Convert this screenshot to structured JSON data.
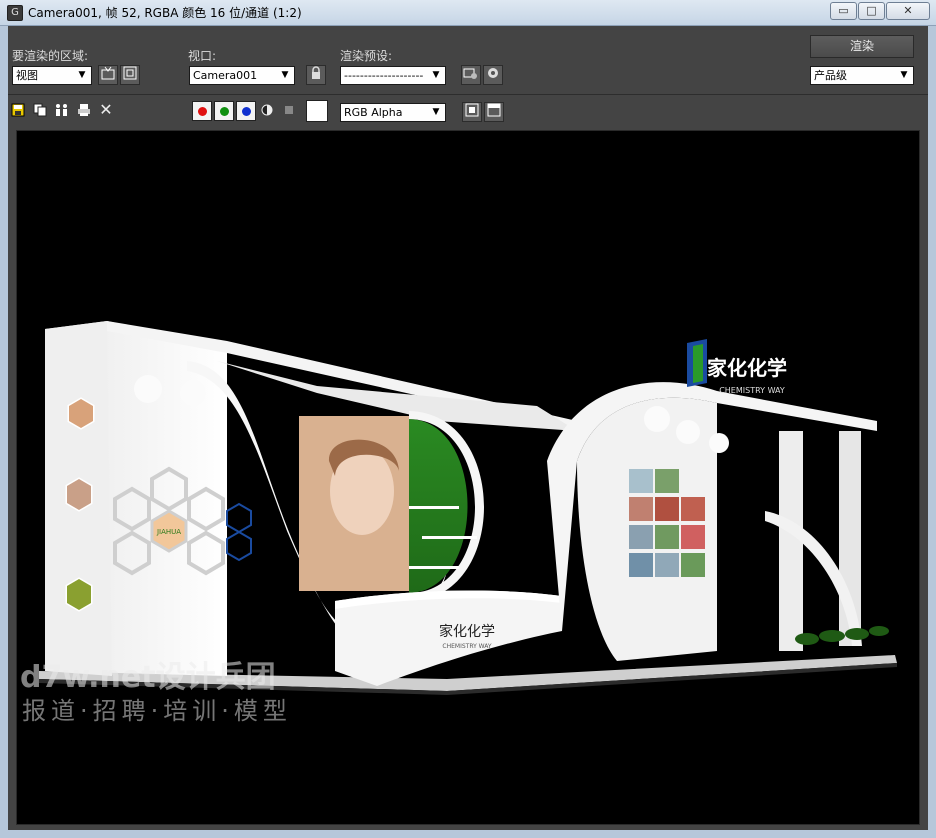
{
  "window": {
    "title": "Camera001, 帧 52, RGBA 颜色 16 位/通道 (1:2)",
    "app_icon_glyph": "G",
    "minimize_glyph": "▭",
    "maximize_glyph": "□",
    "close_glyph": "✕"
  },
  "toolbar": {
    "region_label": "要渲染的区域:",
    "region_value": "视图",
    "viewport_label": "视口:",
    "viewport_value": "Camera001",
    "preset_label": "渲染预设:",
    "preset_value": "--------------------",
    "render_button": "渲染",
    "quality_value": "产品级",
    "channel_value": "RGB Alpha",
    "close_glyph": "✕"
  },
  "channels": {
    "red": "#e01010",
    "green": "#109010",
    "blue": "#1030d0"
  },
  "scene": {
    "booth_logo_text": "家化化学",
    "booth_logo_sub": "CHEMISTRY WAY",
    "desk_logo_text": "家化化学",
    "desk_logo_sub": "CHEMISTRY WAY",
    "hex_logo_text": "JIAHUA"
  },
  "watermark": {
    "line1": "d7w.net设计兵团",
    "line2": "报道·招聘·培训·模型"
  }
}
